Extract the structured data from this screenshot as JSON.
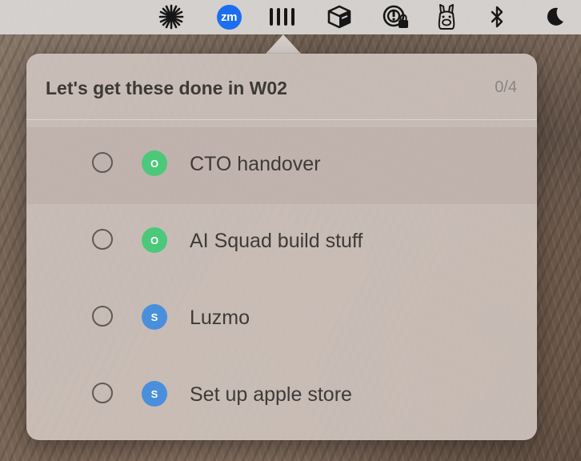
{
  "menubar": {
    "icons": [
      {
        "name": "asterisk-icon"
      },
      {
        "name": "zoom-icon",
        "text": "zm",
        "color": "#1b6ef0"
      },
      {
        "name": "bars-icon"
      },
      {
        "name": "box-icon"
      },
      {
        "name": "privacy-lock-icon"
      },
      {
        "name": "llama-icon"
      },
      {
        "name": "bluetooth-icon"
      },
      {
        "name": "moon-icon"
      }
    ]
  },
  "popover": {
    "title": "Let's get these done in W02",
    "count": "0/4"
  },
  "tasks": [
    {
      "label": "CTO handover",
      "avatar": "O",
      "avatar_color": "#4cc87a",
      "done": false,
      "selected": true
    },
    {
      "label": "AI Squad build stuff",
      "avatar": "O",
      "avatar_color": "#4cc87a",
      "done": false,
      "selected": false
    },
    {
      "label": "Luzmo",
      "avatar": "S",
      "avatar_color": "#4a8fdc",
      "done": false,
      "selected": false
    },
    {
      "label": "Set up apple store",
      "avatar": "S",
      "avatar_color": "#4a8fdc",
      "done": false,
      "selected": false
    }
  ]
}
